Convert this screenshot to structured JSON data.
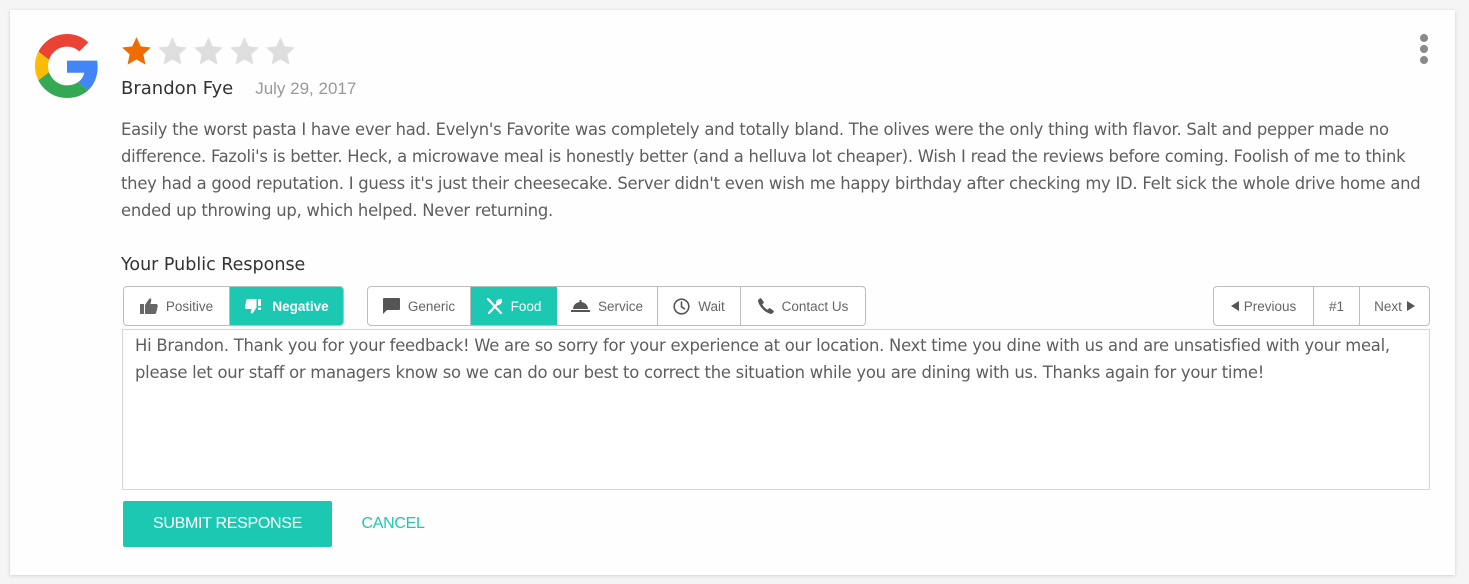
{
  "review": {
    "source": "google",
    "rating": 1,
    "max_rating": 5,
    "author": "Brandon Fye",
    "date": "July 29, 2017",
    "text": "Easily the worst pasta I have ever had. Evelyn's Favorite was completely and totally bland. The olives were the only thing with flavor. Salt and pepper made no difference. Fazoli's is better. Heck, a microwave meal is honestly better (and a helluva lot cheaper). Wish I read the reviews before coming. Foolish of me to think they had a good reputation. I guess it's just their cheesecake. Server didn't even wish me happy birthday after checking my ID. Felt sick the whole drive home and ended up throwing up, which helped. Never returning."
  },
  "response": {
    "title": "Your Public Response",
    "sentiment": [
      {
        "label": "Positive",
        "icon": "thumbs-up-icon",
        "active": false
      },
      {
        "label": "Negative",
        "icon": "thumbs-down-icon",
        "active": true
      }
    ],
    "categories": [
      {
        "label": "Generic",
        "icon": "comment-icon",
        "active": false
      },
      {
        "label": "Food",
        "icon": "utensils-icon",
        "active": true
      },
      {
        "label": "Service",
        "icon": "cloche-icon",
        "active": false
      },
      {
        "label": "Wait",
        "icon": "clock-icon",
        "active": false
      },
      {
        "label": "Contact Us",
        "icon": "phone-icon",
        "active": false
      }
    ],
    "nav": {
      "previous": "Previous",
      "current": "#1",
      "next": "Next"
    },
    "text": "Hi Brandon. Thank you for your feedback! We are so sorry for your experience at our location. Next time you dine with us and are unsatisfied with your meal, please let our staff or managers know so we can do our best to correct the situation while you are dining with us. Thanks again for your time!",
    "submit_label": "SUBMIT RESPONSE",
    "cancel_label": "CANCEL"
  },
  "colors": {
    "accent": "#1dc8b2",
    "star_filled": "#ef6c00",
    "star_empty": "#dedede"
  }
}
